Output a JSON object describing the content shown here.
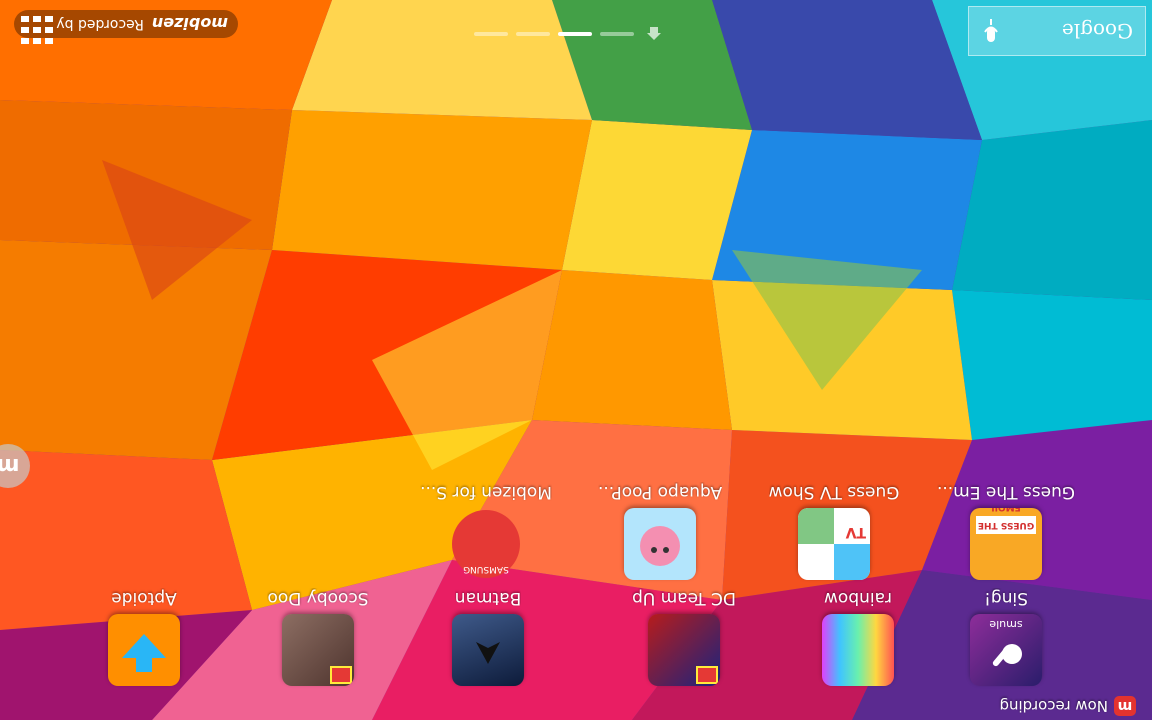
{
  "status_bar": {
    "recording_text": "Now recording",
    "app_badge": "m"
  },
  "apps_row1": [
    {
      "label": "Sing!",
      "icon": "smule-icon",
      "sub": "smule"
    },
    {
      "label": "rainbow",
      "icon": "rainbow-keyboard-icon"
    },
    {
      "label": "DC Team Up",
      "icon": "lego-dc-icon"
    },
    {
      "label": "Batman",
      "icon": "batman-icon"
    },
    {
      "label": "Scooby Doo",
      "icon": "lego-scooby-icon"
    },
    {
      "label": "Aptoide",
      "icon": "aptoide-icon"
    }
  ],
  "apps_row2": [
    {
      "label": "Guess The Em...",
      "icon": "guess-emoji-icon",
      "sub": "GUESS THE EMOJI"
    },
    {
      "label": "Guess TV Show",
      "icon": "guess-tv-icon",
      "sub": "TV"
    },
    {
      "label": "Aquapo PooP...",
      "icon": "aquapo-icon"
    },
    {
      "label": "Mobizen for S...",
      "icon": "mobizen-icon",
      "sub": "SAMSUNG"
    }
  ],
  "google": {
    "label": "Google"
  },
  "watermark": {
    "text": "Recorded by",
    "brand": "mobizen"
  },
  "bubble": {
    "label": "m"
  }
}
